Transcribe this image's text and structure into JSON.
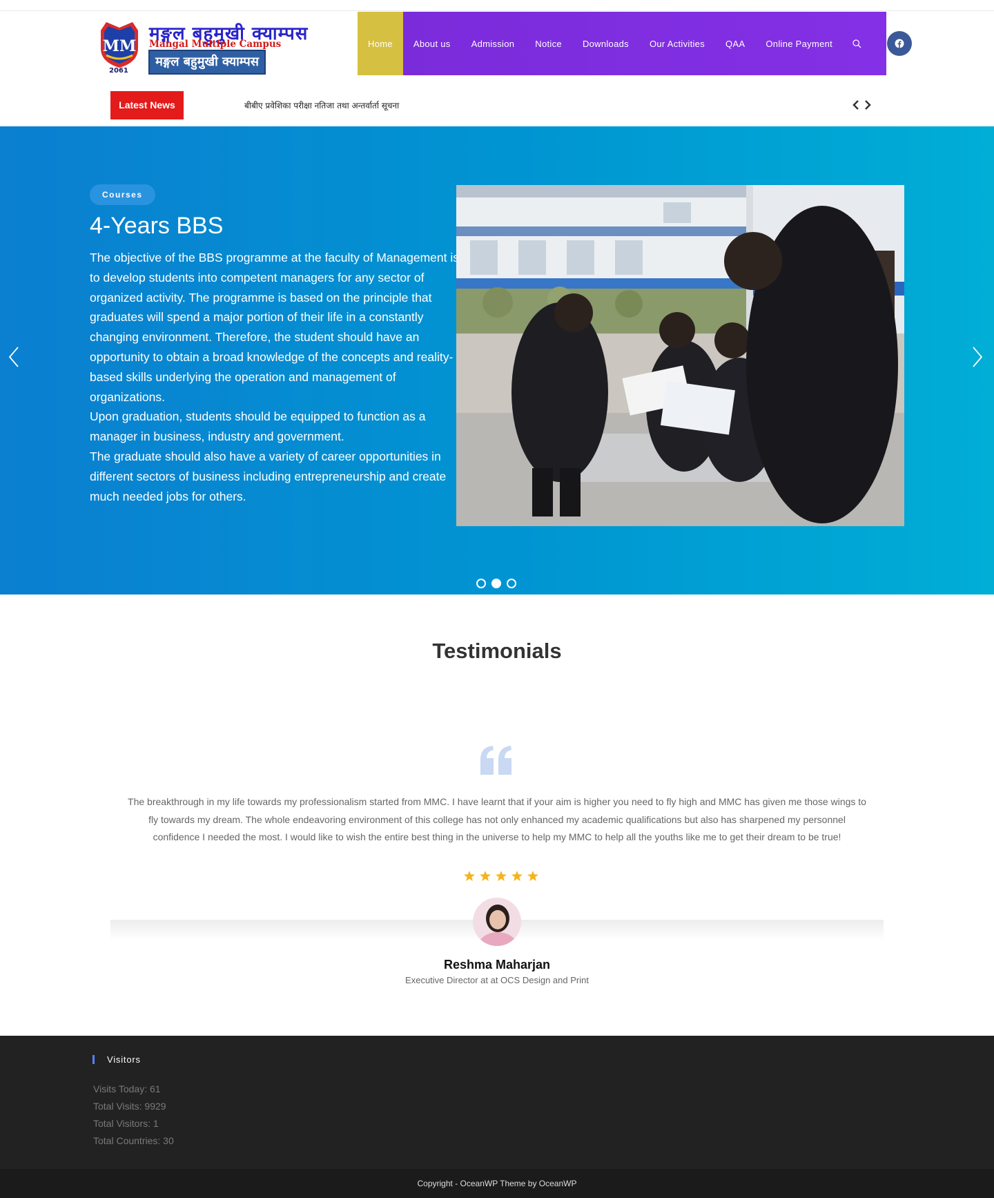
{
  "header": {
    "logo": {
      "line1": "मङ्गल बहुमुखी क्याम्पस",
      "line2": "Mangal Multiple Campus",
      "line3": "मङ्गल बहुमुखी क्याम्पस",
      "year": "2061"
    },
    "nav": [
      {
        "label": "Home",
        "active": true
      },
      {
        "label": "About us"
      },
      {
        "label": "Admission"
      },
      {
        "label": "Notice"
      },
      {
        "label": "Downloads"
      },
      {
        "label": "Our Activities"
      },
      {
        "label": "QAA"
      },
      {
        "label": "Online Payment"
      }
    ],
    "colors": {
      "nav_bg": "#8430e6",
      "nav_active": "#d6c041",
      "facebook": "#3b5998"
    }
  },
  "news": {
    "label": "Latest News",
    "text": "बीबीए प्रवेशिका परीक्षा नतिजा तथा अन्तर्वार्ता सूचना",
    "arrows": "‹ ›"
  },
  "hero": {
    "badge": "Courses",
    "title": "4-Years BBS",
    "paragraphs": [
      "The objective of the BBS programme at the faculty of Management is to develop students into competent managers for any sector of organized activity. The programme is based on the principle that graduates will spend a major portion of their life in a constantly changing environment. Therefore, the student should have an opportunity to obtain a broad knowledge of the concepts and reality- based skills underlying the operation and management of organizations.",
      "Upon graduation, students should be equipped to function as a manager in business, industry and government.",
      "The graduate should also have a variety of career opportunities in different sectors of business including entrepreneurship and create much needed jobs for others."
    ],
    "active_slide": 2,
    "total_slides": 3
  },
  "testimonials": {
    "heading": "Testimonials",
    "quote": "The breakthrough in my life towards my professionalism started from MMC. I have learnt that if your aim is higher you need to fly high and MMC has given me those wings to fly towards my dream. The whole endeavoring environment of this college has not only enhanced my academic qualifications but also has sharpened my personnel confidence I needed the most. I would like to wish the entire best thing in the universe to help my MMC to help all the youths like me to get their dream to be true!",
    "rating": 5,
    "name": "Reshma Maharjan",
    "role": "Executive Director at at OCS Design and Print"
  },
  "footer": {
    "widget_title": "Visitors",
    "stats": [
      "Visits Today: 61",
      "Total Visits: 9929",
      "Total Visitors: 1",
      "Total Countries: 30"
    ],
    "copyright": "Copyright - OceanWP Theme by OceanWP"
  }
}
